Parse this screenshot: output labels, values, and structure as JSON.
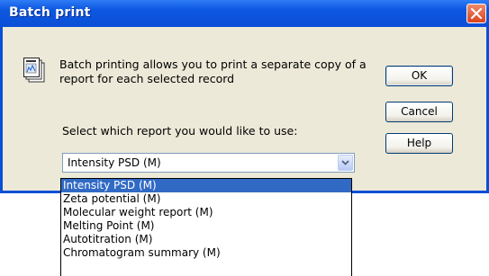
{
  "window": {
    "title": "Batch print"
  },
  "dialog": {
    "description": "Batch printing allows you to print a separate copy of a report for each selected record",
    "select_label": "Select which report you would like to use:",
    "buttons": {
      "ok": "OK",
      "cancel": "Cancel",
      "help": "Help"
    },
    "combo": {
      "value": "Intensity PSD (M)"
    },
    "dropdown_options": [
      "Intensity PSD (M)",
      "Zeta potential (M)",
      "Molecular weight report (M)",
      "Melting Point (M)",
      "Autotitration (M)",
      "Chromatogram summary (M)"
    ],
    "selected_index": 0
  }
}
